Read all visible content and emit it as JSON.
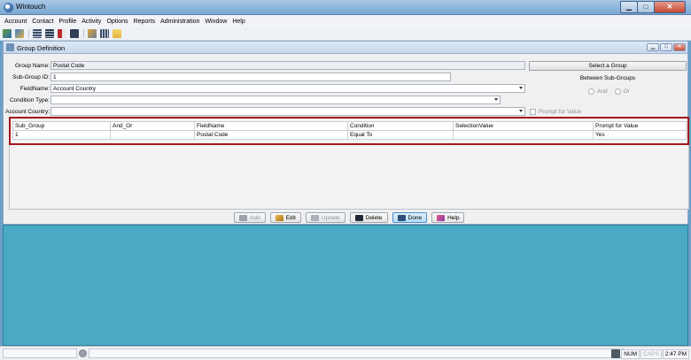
{
  "app": {
    "title": "Wintouch"
  },
  "menu": [
    "Account",
    "Contact",
    "Profile",
    "Activity",
    "Options",
    "Reports",
    "Administration",
    "Window",
    "Help"
  ],
  "toolbar_icons": [
    "contacts-icon",
    "user-icon",
    "list-icon",
    "table-icon",
    "notes-icon",
    "checklist-icon",
    "tools-icon",
    "grid-icon",
    "folder-icon"
  ],
  "window": {
    "title": "Group Definition"
  },
  "form": {
    "group_name_label": "Group Name:",
    "group_name_value": "Postal Code",
    "sub_group_id_label": "Sub-Group ID:",
    "sub_group_id_value": "1",
    "field_name_label": "FieldName:",
    "field_name_value": "Account Country",
    "condition_type_label": "Condition Type:",
    "condition_type_value": "",
    "account_country_label": "Account Country:",
    "account_country_value": ""
  },
  "side": {
    "select_group_label": "Select a Group",
    "between_label": "Between Sub-Groups",
    "and_label": "And",
    "or_label": "Or",
    "prompt_label": "Prompt for Value"
  },
  "grid": {
    "columns": [
      "Sub_Group",
      "And_Or",
      "FieldName",
      "Condition",
      "SelectionValue",
      "Prompt for Value"
    ],
    "rows": [
      [
        "1",
        "",
        "Postal Code",
        "Equal To",
        "",
        "Yes"
      ]
    ]
  },
  "buttons": {
    "add": "Add",
    "edit": "Edit",
    "update": "Update",
    "delete": "Delete",
    "done": "Done",
    "help": "Help"
  },
  "status": {
    "num": "NUM",
    "caps": "CAPS",
    "time": "2:47 PM"
  },
  "colors": {
    "highlight": "#a1161b",
    "workspace": "#4aaac6"
  }
}
